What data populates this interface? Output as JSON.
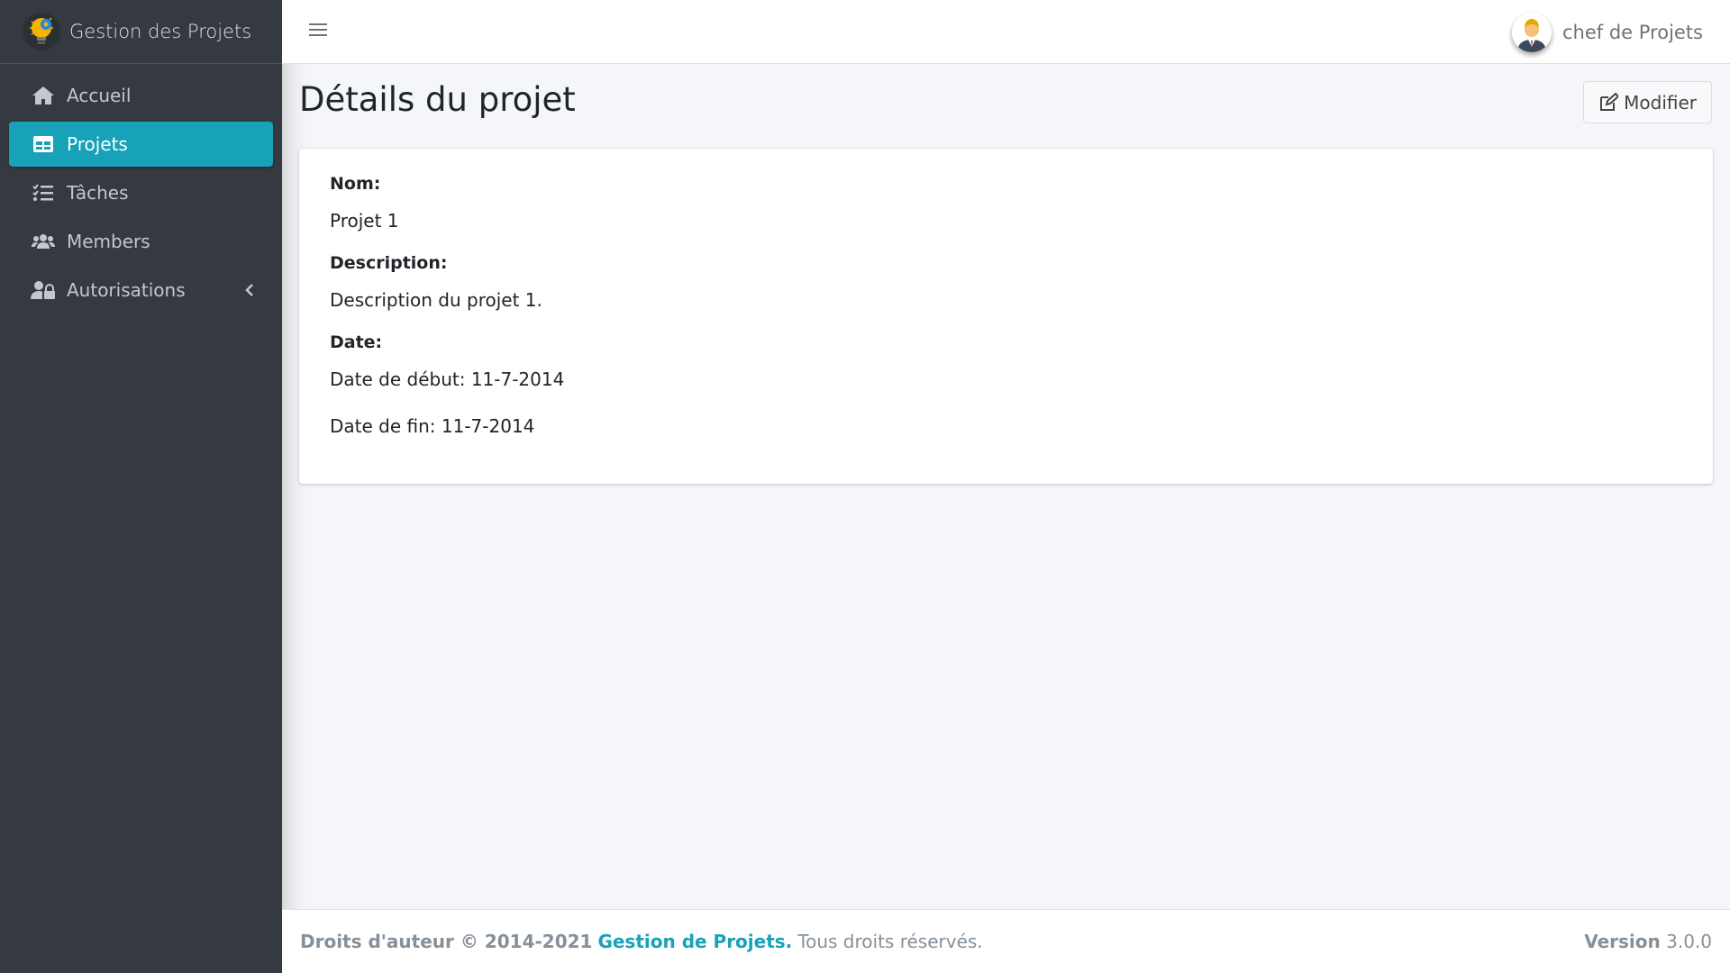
{
  "brand": {
    "title": "Gestion des Projets",
    "logo_icon": "lightbulb-gear-icon"
  },
  "sidebar": {
    "items": [
      {
        "label": "Accueil",
        "icon": "home-icon",
        "active": false
      },
      {
        "label": "Projets",
        "icon": "table-icon",
        "active": true
      },
      {
        "label": "Tâches",
        "icon": "tasks-icon",
        "active": false
      },
      {
        "label": "Members",
        "icon": "users-icon",
        "active": false
      },
      {
        "label": "Autorisations",
        "icon": "user-lock-icon",
        "active": false,
        "has_submenu": true
      }
    ]
  },
  "header": {
    "user_name": "chef de Projets"
  },
  "page": {
    "title": "Détails du projet",
    "edit_label": "Modifier"
  },
  "project": {
    "name_label": "Nom:",
    "name": "Projet 1",
    "description_label": "Description:",
    "description": "Description du projet 1.",
    "date_label": "Date:",
    "start_date": "Date de début: 11-7-2014",
    "end_date": "Date de fin: 11-7-2014"
  },
  "footer": {
    "copyright": "Droits d'auteur © 2014-2021",
    "company": "Gestion de Projets.",
    "rights": "Tous droits réservés.",
    "version_label": "Version",
    "version": "3.0.0"
  },
  "colors": {
    "accent": "#17a2b8",
    "sidebar_bg": "#343a40",
    "content_bg": "#f4f6f9"
  }
}
